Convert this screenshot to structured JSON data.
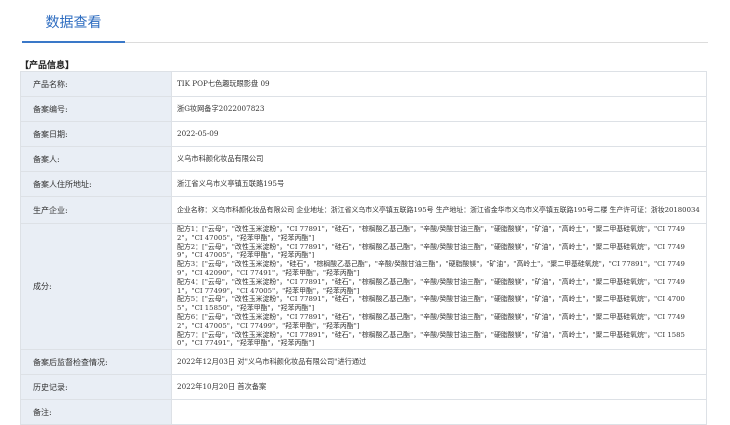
{
  "tabs": {
    "active_label": "数据查看"
  },
  "section": {
    "title": "【产品信息】"
  },
  "rows": {
    "product_name": {
      "label": "产品名称:",
      "value": "TIK POP七色趣玩眼影盘 09"
    },
    "record_no": {
      "label": "备案编号:",
      "value": "浙G妆网备字2022007823"
    },
    "record_date": {
      "label": "备案日期:",
      "value": "2022-05-09"
    },
    "registrant": {
      "label": "备案人:",
      "value": "义乌市科颜化妆品有限公司"
    },
    "registrant_address": {
      "label": "备案人住所地址:",
      "value": "浙江省义乌市义亭镇五联路195号"
    },
    "manufacturer": {
      "label": "生产企业:",
      "value": "企业名称：义乌市科颜化妆品有限公司 企业地址：浙江省义乌市义亭镇五联路195号 生产地址：浙江省金华市义乌市义亭镇五联路195号二楼 生产许可证：浙妆20180034"
    },
    "ingredients": {
      "label": "成分:",
      "formulas": [
        "配方1：[\"云母\"，\"改性玉米淀粉\"，\"CI 77891\"，\"硅石\"，\"棕榈酸乙基己酯\"，\"辛酸/癸酸甘油三酯\"，\"硬脂酸镁\"，\"矿油\"，\"高岭土\"，\"聚二甲基硅氧烷\"，\"CI 77492\"，\"CI 47005\"，\"羟苯甲酯\"，\"羟苯丙酯\"]",
        "配方2：[\"云母\"，\"改性玉米淀粉\"，\"CI 77891\"，\"硅石\"，\"棕榈酸乙基己酯\"，\"辛酸/癸酸甘油三酯\"，\"硬脂酸镁\"，\"矿油\"，\"高岭土\"，\"聚二甲基硅氧烷\"，\"CI 77499\"，\"CI 47005\"，\"羟苯甲酯\"，\"羟苯丙酯\"]",
        "配方3：[\"云母\"，\"改性玉米淀粉\"，\"硅石\"，\"棕榈酸乙基己酯\"，\"辛酸/癸酸甘油三酯\"，\"硬脂酸镁\"，\"矿油\"，\"高岭土\"，\"聚二甲基硅氧烷\"，\"CI 77891\"，\"CI 77499\"，\"CI 42090\"，\"CI 77491\"，\"羟苯甲酯\"，\"羟苯丙酯\"]",
        "配方4：[\"云母\"，\"改性玉米淀粉\"，\"CI 77891\"，\"硅石\"，\"棕榈酸乙基己酯\"，\"辛酸/癸酸甘油三酯\"，\"硬脂酸镁\"，\"矿油\"，\"高岭土\"，\"聚二甲基硅氧烷\"，\"CI 77491\"，\"CI 77499\"，\"CI 47005\"，\"羟苯甲酯\"，\"羟苯丙酯\"]",
        "配方5：[\"云母\"，\"改性玉米淀粉\"，\"CI 77891\"，\"硅石\"，\"棕榈酸乙基己酯\"，\"辛酸/癸酸甘油三酯\"，\"硬脂酸镁\"，\"矿油\"，\"高岭土\"，\"聚二甲基硅氧烷\"，\"CI 47005\"，\"CI 15850\"，\"羟苯甲酯\"，\"羟苯丙酯\"]",
        "配方6：[\"云母\"，\"改性玉米淀粉\"，\"CI 77891\"，\"硅石\"，\"棕榈酸乙基己酯\"，\"辛酸/癸酸甘油三酯\"，\"硬脂酸镁\"，\"矿油\"，\"高岭土\"，\"聚二甲基硅氧烷\"，\"CI 77492\"，\"CI 47005\"，\"CI 77499\"，\"羟苯甲酯\"，\"羟苯丙酯\"]",
        "配方7：[\"云母\"，\"改性玉米淀粉\"，\"CI 77891\"，\"硅石\"，\"棕榈酸乙基己酯\"，\"辛酸/癸酸甘油三酯\"，\"硬脂酸镁\"，\"矿油\"，\"高岭土\"，\"聚二甲基硅氧烷\"，\"CI 15850\"，\"CI 77491\"，\"羟苯甲酯\"，\"羟苯丙酯\"]"
      ]
    },
    "post_inspection": {
      "label": "备案后监督检查情况:",
      "value": "2022年12月03日 对\"义乌市科颜化妆品有限公司\"进行通过"
    },
    "history": {
      "label": "历史记录:",
      "value": "2022年10月20日 首次备案"
    },
    "remarks": {
      "label": "备注:",
      "value": ""
    }
  },
  "colors": {
    "accent": "#2d6cc0",
    "label_bg": "#e9eef5",
    "border": "#dde1e6"
  }
}
